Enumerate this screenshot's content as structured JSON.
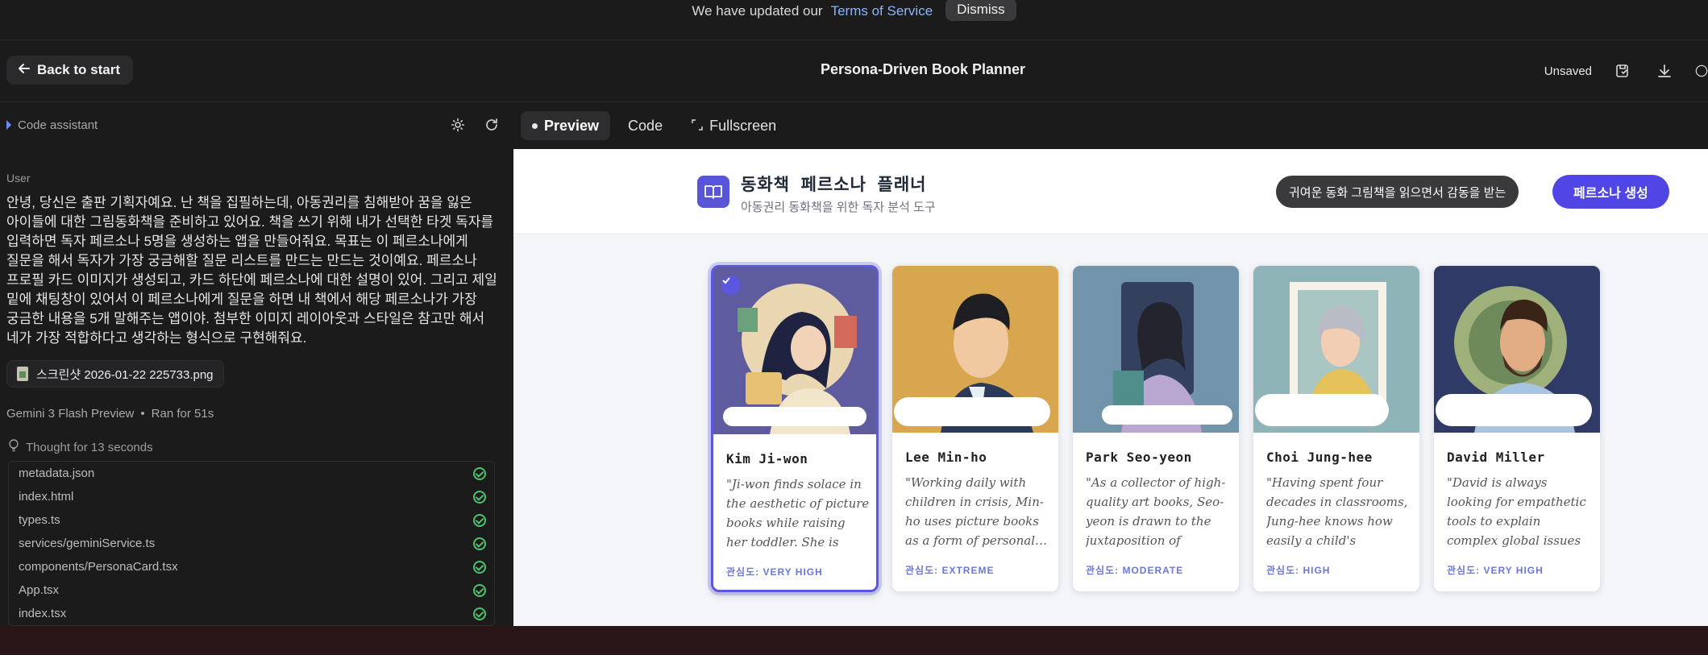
{
  "notice": {
    "text": "We have updated our",
    "link": "Terms of Service",
    "dismiss": "Dismiss"
  },
  "header": {
    "back_label": "Back to start",
    "title": "Persona-Driven Book Planner",
    "status": "Unsaved"
  },
  "left": {
    "assistant_label": "Code assistant",
    "user_label": "User",
    "user_message": "안녕, 당신은 출판 기획자예요. 난 책을 집필하는데, 아동권리를 침해받아 꿈을 잃은 아이들에 대한 그림동화책을 준비하고 있어요. 책을 쓰기 위해 내가 선택한 타겟 독자를 입력하면 독자 페르소나 5명을 생성하는 앱을 만들어줘요. 목표는 이 페르소나에게 질문을 해서 독자가 가장 궁금해할 질문 리스트를 만드는 만드는 것이예요. 페르소나 프로필 카드 이미지가 생성되고, 카드 하단에 페르소나에 대한 설명이 있어. 그리고 제일 밑에 채팅창이 있어서 이 페르소나에게 질문을 하면 내 책에서 해당 페르소나가 가장 궁금한 내용을 5개 말해주는 앱이야. 첨부한 이미지 레이아웃과 스타일은 참고만 해서 네가 가장 적합하다고 생각하는 형식으로 구현해줘요.",
    "attachment": "스크린샷 2026-01-22 225733.png",
    "model": "Gemini 3 Flash Preview",
    "ran_for": "Ran for 51s",
    "thought": "Thought for 13 seconds",
    "files": [
      "metadata.json",
      "index.html",
      "types.ts",
      "services/geminiService.ts",
      "components/PersonaCard.tsx",
      "App.tsx",
      "index.tsx"
    ]
  },
  "tabs": [
    "Preview",
    "Code",
    "Fullscreen"
  ],
  "preview": {
    "title": "동화책 페르소나 플래너",
    "subtitle": "아동권리 동화책을 위한 독자 분석 도구",
    "target_reader": "귀여운 동화 그림책을 읽으면서 감동을 받는",
    "generate_label": "페르소나 생성",
    "cards": [
      {
        "name": "Kim Ji-won",
        "quote": "\"Ji-won finds solace in the aesthetic of picture books while raising her toddler. She is deeply…",
        "interest": "관심도: VERY HIGH",
        "bg": "#4a5a8a"
      },
      {
        "name": "Lee Min-ho",
        "quote": "\"Working daily with children in crisis, Min-ho uses picture books as a form of personal…",
        "interest": "관심도: EXTREME",
        "bg": "#d9a54a"
      },
      {
        "name": "Park Seo-yeon",
        "quote": "\"As a collector of high-quality art books, Seo-yeon is drawn to the juxtaposition of 'cute'…",
        "interest": "관심도: MODERATE",
        "bg": "#6f8fa6"
      },
      {
        "name": "Choi Jung-hee",
        "quote": "\"Having spent four decades in classrooms, Jung-hee knows how easily a child's dream…",
        "interest": "관심도: HIGH",
        "bg": "#8fb3b8"
      },
      {
        "name": "David Miller",
        "quote": "\"David is always looking for empathetic tools to explain complex global issues to donors. He…",
        "interest": "관심도: VERY HIGH",
        "bg": "#2e3a66"
      }
    ]
  }
}
